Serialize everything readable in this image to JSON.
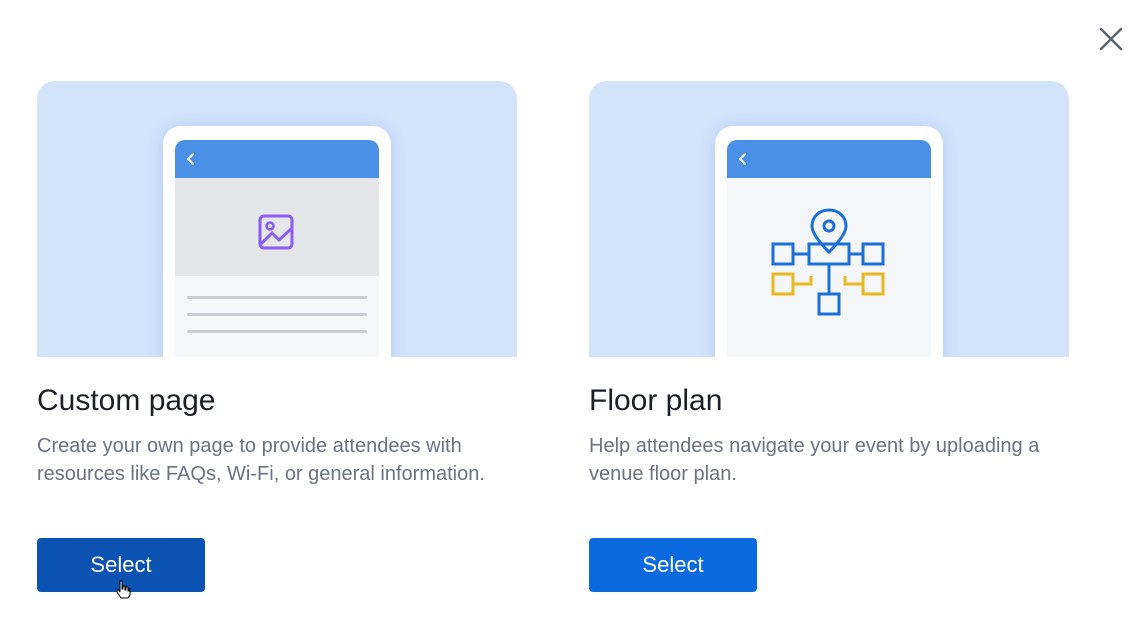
{
  "dialog": {
    "close_icon": "close-icon"
  },
  "cards": [
    {
      "title": "Custom page",
      "description": "Create your own page to provide attendees with resources like FAQs, Wi-Fi, or general information.",
      "button_label": "Select",
      "illustration": "image-icon",
      "button_color": "#0b52b2"
    },
    {
      "title": "Floor plan",
      "description": "Help attendees navigate your event by uploading a venue floor plan.",
      "button_label": "Select",
      "illustration": "floor-plan-icon",
      "button_color": "#0c6ae0"
    }
  ],
  "colors": {
    "illustration_bg": "#d2e3fa",
    "phone_header": "#4a90e6",
    "image_icon": "#8b5cf6",
    "plan_blue": "#1a6fd8",
    "plan_yellow": "#e8b820"
  }
}
